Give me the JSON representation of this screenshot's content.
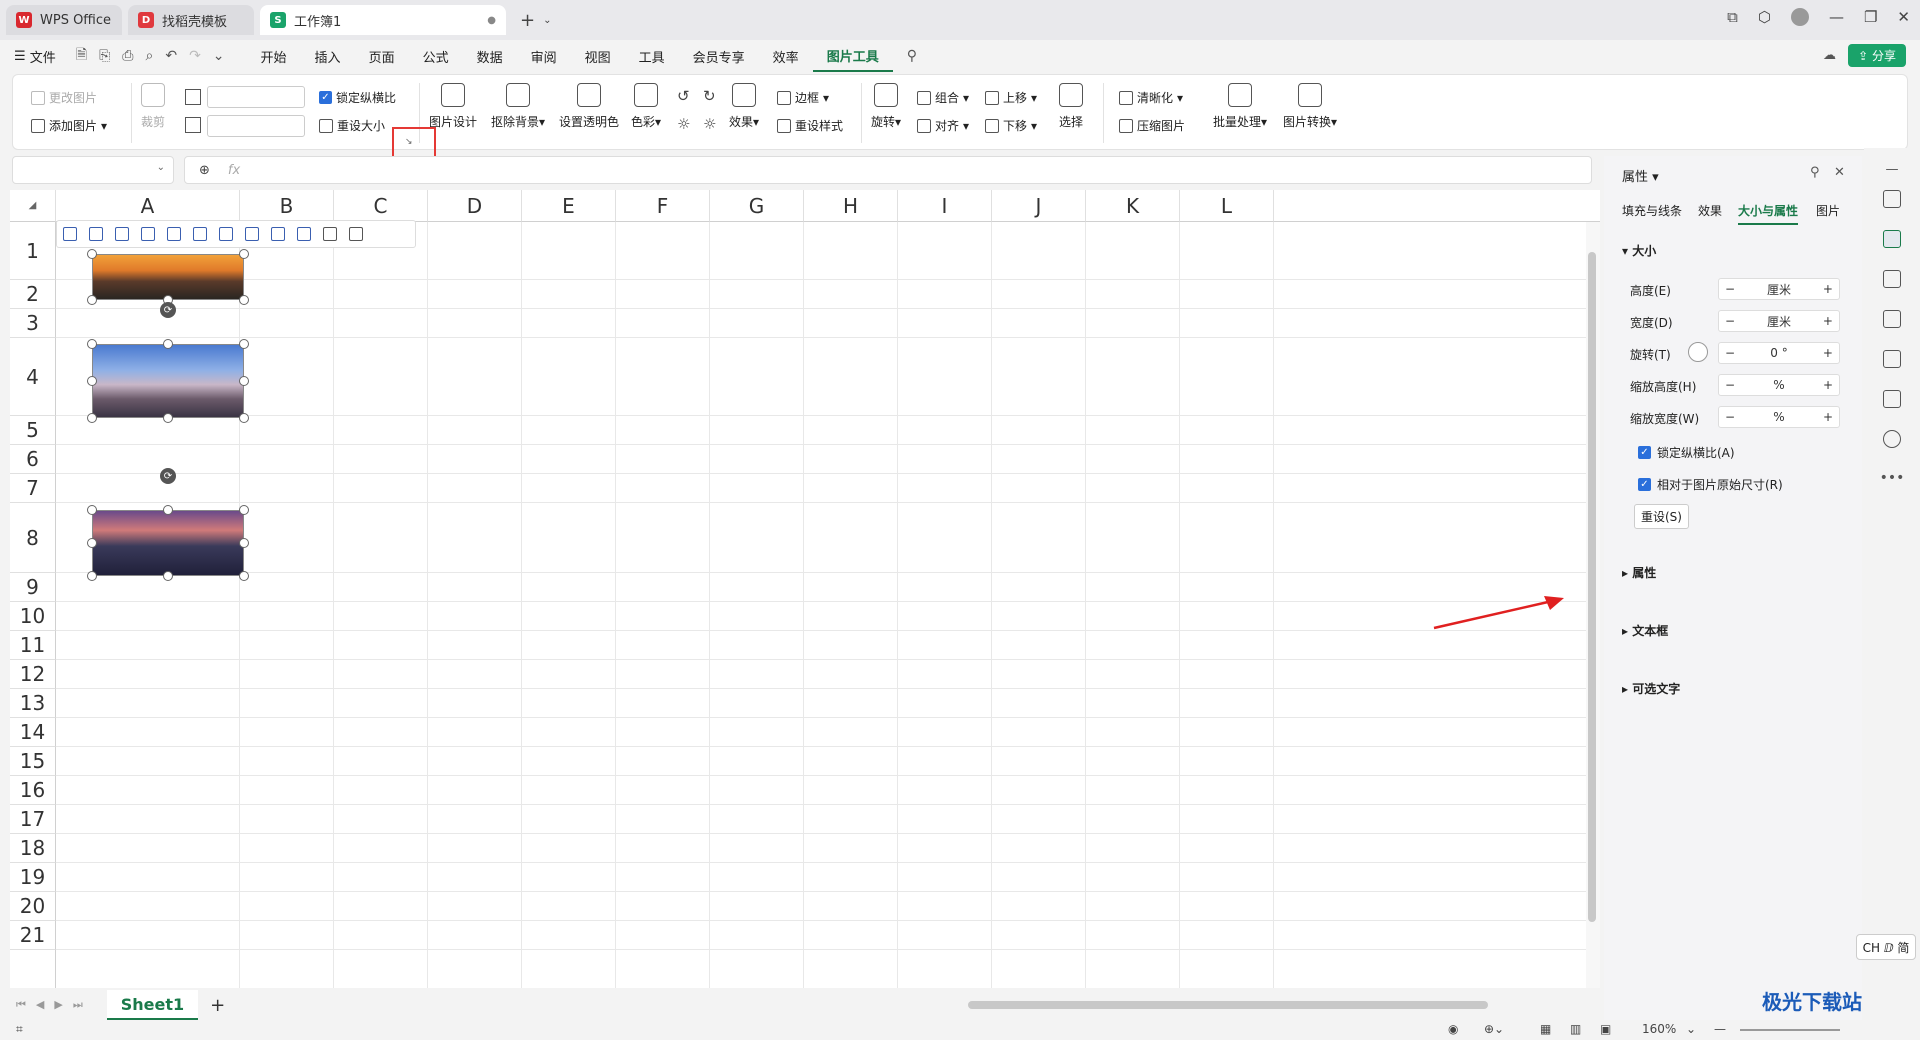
{
  "tabs": [
    {
      "label": "WPS Office",
      "logo": "W"
    },
    {
      "label": "找稻壳模板",
      "logo": "D"
    },
    {
      "label": "工作簿1",
      "logo": "S"
    }
  ],
  "menu": {
    "file": "文件",
    "items": [
      "开始",
      "插入",
      "页面",
      "公式",
      "数据",
      "审阅",
      "视图",
      "工具",
      "会员专享",
      "效率",
      "图片工具"
    ],
    "share": "分享"
  },
  "ribbon": {
    "change_pic": "更改图片",
    "add_pic": "添加图片",
    "crop": "裁剪",
    "lock_ratio": "锁定纵横比",
    "reset_size": "重设大小",
    "pic_design": "图片设计",
    "remove_bg": "抠除背景",
    "set_transparent": "设置透明色",
    "color": "色彩",
    "effects": "效果",
    "border": "边框",
    "reset_style": "重设样式",
    "rotate": "旋转",
    "group": "组合",
    "align": "对齐",
    "bring_forward": "上移",
    "send_backward": "下移",
    "select": "选择",
    "sharpen": "清晰化",
    "compress": "压缩图片",
    "batch": "批量处理",
    "convert": "图片转换"
  },
  "formula": {
    "fx": "fx"
  },
  "columns": [
    "A",
    "B",
    "C",
    "D",
    "E",
    "F",
    "G",
    "H",
    "I",
    "J",
    "K",
    "L"
  ],
  "rows": [
    "1",
    "2",
    "3",
    "4",
    "5",
    "6",
    "7",
    "8",
    "9",
    "10",
    "11",
    "12",
    "13",
    "14",
    "15",
    "16",
    "17",
    "18",
    "19",
    "20",
    "21"
  ],
  "sheet_tab": "Sheet1",
  "panel": {
    "title": "属性",
    "tabs": [
      "填充与线条",
      "效果",
      "大小与属性",
      "图片"
    ],
    "size_section": "大小",
    "height_label": "高度(E)",
    "width_label": "宽度(D)",
    "rotate_label": "旋转(T)",
    "scale_h_label": "缩放高度(H)",
    "scale_w_label": "缩放宽度(W)",
    "unit_cm": "厘米",
    "rotate_value": "0 °",
    "percent": "%",
    "lock_ratio": "锁定纵横比(A)",
    "relative_orig": "相对于图片原始尺寸(R)",
    "reset_btn": "重设(S)",
    "sec_props": "属性",
    "sec_textbox": "文本框",
    "sec_alt": "可选文字"
  },
  "status": {
    "zoom": "160%"
  },
  "ime": "CH ⅅ 简",
  "watermark": "极光下载站"
}
